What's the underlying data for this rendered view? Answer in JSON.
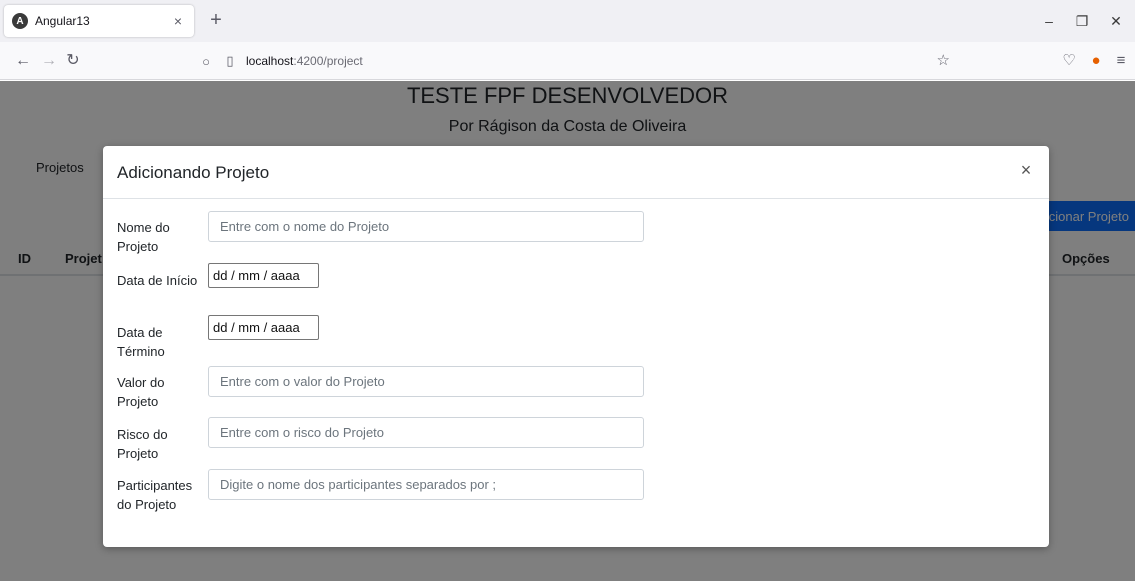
{
  "browser": {
    "tab_title": "Angular13",
    "tab_close": "×",
    "new_tab": "+",
    "url_host": "localhost",
    "url_path": ":4200/project",
    "window_controls": [
      "–",
      "❐",
      "✕"
    ]
  },
  "page": {
    "title": "TESTE FPF DESENVOLVEDOR",
    "subtitle": "Por Rágison da Costa de Oliveira",
    "menu_item": "Projetos",
    "add_button": "cionar Projeto",
    "table_headers": {
      "id": "ID",
      "project": "Projet",
      "options": "Opções"
    }
  },
  "modal": {
    "title": "Adicionando Projeto",
    "close": "×",
    "fields": {
      "nome": {
        "label": "Nome do Projeto",
        "placeholder": "Entre com o nome do Projeto"
      },
      "inicio": {
        "label": "Data de Início",
        "value": "dd / mm / aaaa"
      },
      "termino": {
        "label": "Data de Término",
        "value": "dd / mm / aaaa"
      },
      "valor": {
        "label": "Valor do Projeto",
        "placeholder": "Entre com o valor do Projeto"
      },
      "risco": {
        "label": "Risco do Projeto",
        "placeholder": "Entre com o risco do Projeto"
      },
      "participantes": {
        "label": "Participantes do Projeto",
        "placeholder": "Digite o nome dos participantes separados por ;"
      }
    }
  },
  "colors": {
    "primary": "#0d6efd",
    "overlay": "rgba(0,0,0,0.5)",
    "chrome": "#f0f0f4"
  },
  "icons": [
    "angular-icon",
    "back-icon",
    "forward-icon",
    "reload-icon",
    "shield-icon",
    "page-icon",
    "star-icon",
    "pocket-icon",
    "profile-icon",
    "menu-icon"
  ]
}
